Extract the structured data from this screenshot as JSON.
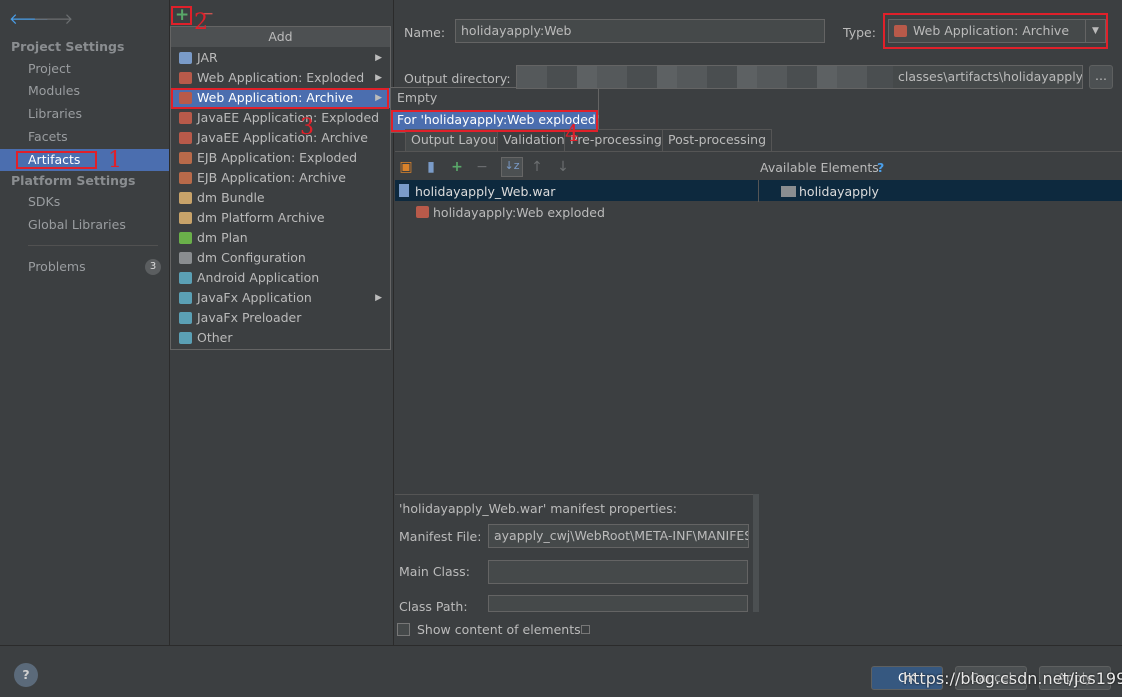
{
  "nav": {
    "back_icon": "arrow-left-icon",
    "forward_icon": "arrow-right-icon"
  },
  "sidebar": {
    "project_settings": "Project Settings",
    "project_items": [
      "Project",
      "Modules",
      "Libraries",
      "Facets",
      "Artifacts"
    ],
    "platform_settings": "Platform Settings",
    "platform_items": [
      "SDKs",
      "Global Libraries"
    ],
    "problems_label": "Problems",
    "problems_count": "3"
  },
  "toolbar": {
    "add": "+",
    "remove": "−"
  },
  "add_menu": {
    "title": "Add",
    "items": [
      {
        "label": "JAR",
        "submenu": true
      },
      {
        "label": "Web Application: Exploded",
        "submenu": true
      },
      {
        "label": "Web Application: Archive",
        "submenu": true,
        "selected": true
      },
      {
        "label": "JavaEE Application: Exploded",
        "submenu": false
      },
      {
        "label": "JavaEE Application: Archive",
        "submenu": false
      },
      {
        "label": "EJB Application: Exploded",
        "submenu": false
      },
      {
        "label": "EJB Application: Archive",
        "submenu": false
      },
      {
        "label": "dm Bundle",
        "submenu": false
      },
      {
        "label": "dm Platform Archive",
        "submenu": false
      },
      {
        "label": "dm Plan",
        "submenu": false
      },
      {
        "label": "dm Configuration",
        "submenu": false
      },
      {
        "label": "Android Application",
        "submenu": false
      },
      {
        "label": "JavaFx Application",
        "submenu": true
      },
      {
        "label": "JavaFx Preloader",
        "submenu": false
      },
      {
        "label": "Other",
        "submenu": false
      }
    ]
  },
  "submenu": {
    "items": [
      "Empty",
      "For 'holidayapply:Web exploded'"
    ]
  },
  "form": {
    "name_label": "Name:",
    "name_value": "holidayapply:Web",
    "type_label": "Type:",
    "type_value": "Web Application: Archive",
    "output_label": "Output directory:",
    "output_value": "classes\\artifacts\\holidayapply_\\",
    "browse": "..."
  },
  "tabs": [
    "Output Layout",
    "Validation",
    "Pre-processing",
    "Post-processing"
  ],
  "tree": {
    "root": "holidayapply_Web.war",
    "child": "holidayapply:Web exploded"
  },
  "available": {
    "header": "Available Elements",
    "help": "?",
    "item": "holidayapply"
  },
  "manifest": {
    "title": "'holidayapply_Web.war' manifest properties:",
    "file_label": "Manifest File:",
    "file_value": "ayapply_cwj\\WebRoot\\META-INF\\MANIFEST.M",
    "main_class_label": "Main Class:",
    "class_path_label": "Class Path:"
  },
  "show_content": "Show content of elements",
  "footer": {
    "help": "?",
    "ok": "OK",
    "cancel": "Cancel",
    "apply": "Apply",
    "watermark": "https://blog.csdn.net/jcs1992"
  },
  "annotations": [
    "1",
    "2",
    "3",
    "4"
  ],
  "colors": {
    "selection": "#4b6eaf",
    "annotation": "#e0202a",
    "background": "#3c3f41"
  }
}
